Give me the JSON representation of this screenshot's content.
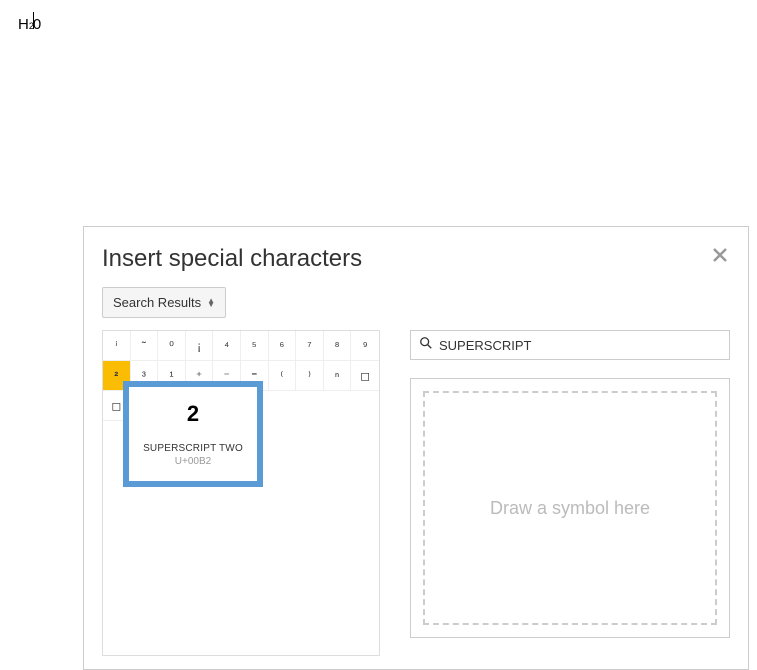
{
  "document": {
    "text_h": "H",
    "text_sup": "2",
    "text_0": "0"
  },
  "dialog": {
    "title": "Insert special characters",
    "dropdown_label": "Search Results",
    "search_value": "SUPERSCRIPT"
  },
  "grid": {
    "row1": [
      "ⁱ",
      "˜",
      "⁰",
      "¡",
      "⁴",
      "⁵",
      "⁶",
      "⁷",
      "⁸",
      "⁹"
    ],
    "row2": [
      "²",
      "³",
      "¹",
      "⁺",
      "⁻",
      "⁼",
      "⁽",
      "⁾",
      "ⁿ",
      "◻"
    ],
    "row3": [
      "◻",
      "",
      "",
      "",
      "",
      "",
      "",
      "",
      "",
      ""
    ]
  },
  "tooltip": {
    "char": "2",
    "name": "SUPERSCRIPT TWO",
    "code": "U+00B2"
  },
  "draw": {
    "placeholder": "Draw a symbol here"
  }
}
